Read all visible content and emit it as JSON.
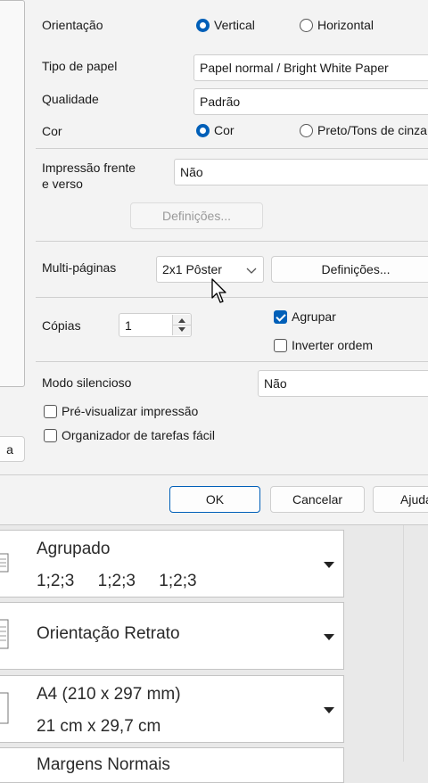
{
  "dialog": {
    "orientation": {
      "label": "Orientação",
      "options": [
        "Vertical",
        "Horizontal"
      ]
    },
    "paper_type": {
      "label": "Tipo de papel",
      "value": "Papel normal / Bright White Paper"
    },
    "quality": {
      "label": "Qualidade",
      "value": "Padrão"
    },
    "color": {
      "label": "Cor",
      "options": [
        "Cor",
        "Preto/Tons de cinza"
      ]
    },
    "duplex": {
      "label_line1": "Impressão frente",
      "label_line2": "e verso",
      "value": "Não",
      "settings_label": "Definições..."
    },
    "multipage": {
      "label": "Multi-páginas",
      "value": "2x1 Pôster",
      "settings_label": "Definições..."
    },
    "copies": {
      "label": "Cópias",
      "value": "1"
    },
    "collate": {
      "label": "Agrupar"
    },
    "reverse": {
      "label": "Inverter ordem"
    },
    "quiet_mode": {
      "label": "Modo silencioso",
      "value": "Não"
    },
    "preview": {
      "label": "Pré-visualizar impressão"
    },
    "organizer": {
      "label": "Organizador de tarefas fácil"
    },
    "left_button_label": "a",
    "buttons": {
      "ok": "OK",
      "cancel": "Cancelar",
      "help": "Ajuda"
    }
  },
  "settings_cards": [
    {
      "title": "Agrupado",
      "subtitle": "1;2;3     1;2;3     1;2;3",
      "icon": "collate-pages-icon"
    },
    {
      "title": "Orientação Retrato",
      "subtitle": "",
      "icon": "portrait-page-icon"
    },
    {
      "title": "A4 (210 x 297 mm)",
      "subtitle": "21 cm x 29,7 cm",
      "icon": "paper-size-icon"
    },
    {
      "title": "Margens Normais",
      "subtitle": "",
      "icon": "margins-icon"
    }
  ],
  "colors": {
    "accent": "#005fb8",
    "dialog_bg": "#f3f3f3",
    "panel_bg": "#e9e9e9"
  }
}
